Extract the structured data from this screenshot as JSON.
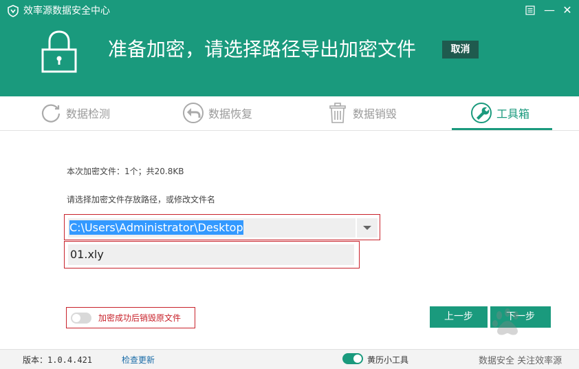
{
  "window": {
    "title": "效率源数据安全中心",
    "menu_icon": "hamburger-menu-icon",
    "minimize_glyph": "—",
    "close_glyph": "✕"
  },
  "header": {
    "headline": "准备加密，请选择路径导出加密文件",
    "cancel_label": "取消",
    "bg_color": "#1a9a7d"
  },
  "tabs": [
    {
      "label": "数据检测",
      "icon": "refresh-circle-icon"
    },
    {
      "label": "数据恢复",
      "icon": "undo-circle-icon"
    },
    {
      "label": "数据销毁",
      "icon": "trash-icon"
    },
    {
      "label": "工具箱",
      "icon": "wrench-icon",
      "active": true
    }
  ],
  "main": {
    "file_info": "本次加密文件：1个；共20.8KB",
    "path_prompt": "请选择加密文件存放路径，或修改文件名",
    "path_value": "C:\\Users\\Administrator\\Desktop",
    "file_name": "01.xly",
    "option_label": "加密成功后销毁原文件",
    "option_enabled": false,
    "prev_label": "上一步",
    "next_label": "下一步"
  },
  "footer": {
    "version": "版本：1.0.4.421",
    "update_link": "检查更新",
    "calendar_tool": "黄历小工具",
    "calendar_enabled": true,
    "slogan": "数据安全 关注效率源"
  }
}
